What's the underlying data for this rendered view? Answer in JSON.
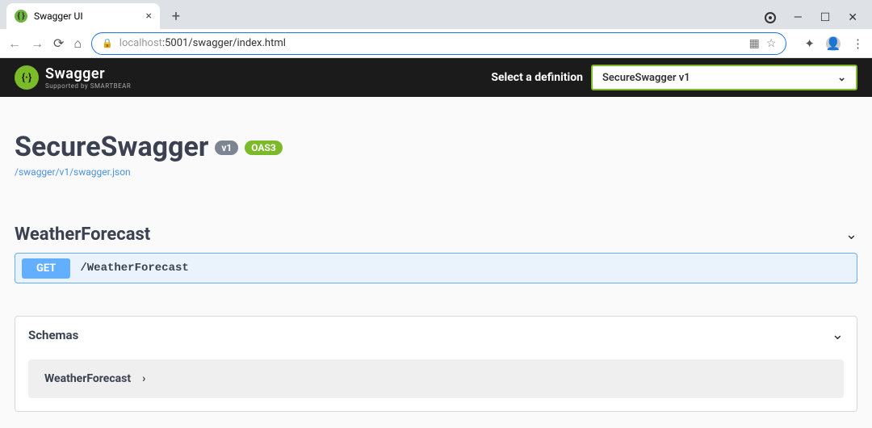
{
  "browser": {
    "tab_title": "Swagger UI",
    "url_fade": "localhost",
    "url_rest": ":5001/swagger/index.html"
  },
  "swagger_header": {
    "brand": "Swagger",
    "supported_by": "Supported by SMARTBEAR",
    "select_label": "Select a definition",
    "selected_definition": "SecureSwagger v1"
  },
  "api": {
    "title": "SecureSwagger",
    "version_badge": "v1",
    "oas_badge": "OAS3",
    "spec_link": "/swagger/v1/swagger.json"
  },
  "tag": {
    "name": "WeatherForecast"
  },
  "endpoints": [
    {
      "method": "GET",
      "path": "/WeatherForecast"
    }
  ],
  "schemas": {
    "title": "Schemas",
    "items": [
      "WeatherForecast"
    ]
  }
}
